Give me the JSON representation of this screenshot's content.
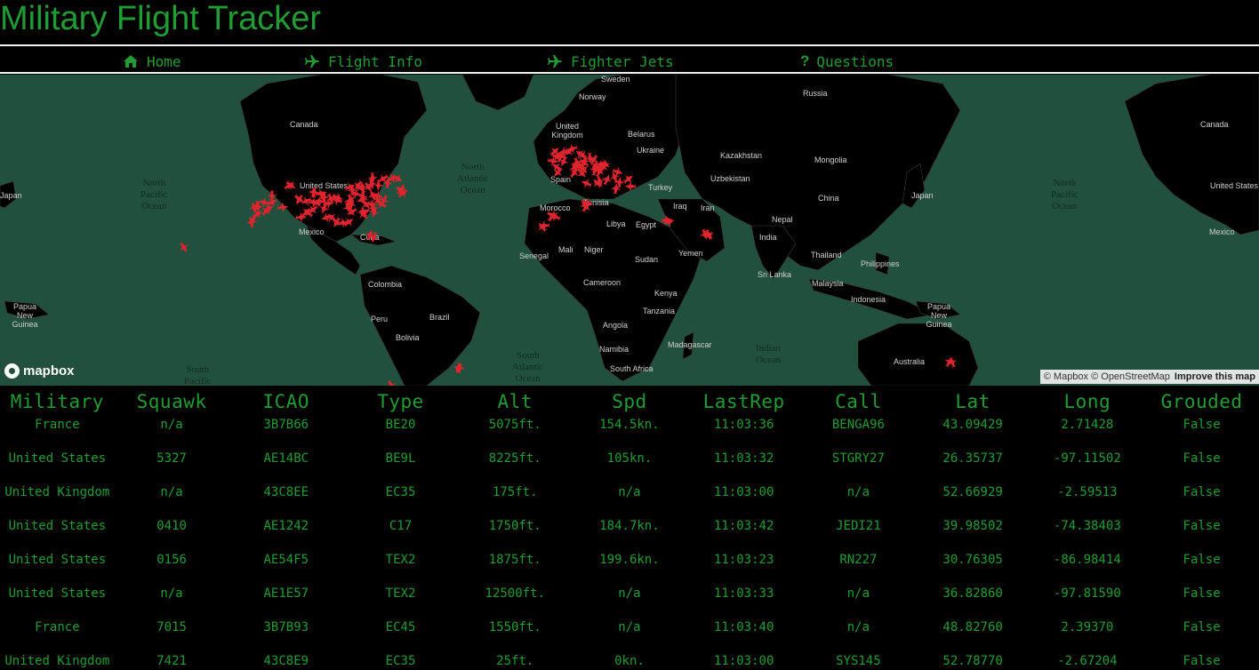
{
  "app": {
    "title": "Military Flight Tracker"
  },
  "nav": [
    {
      "label": "Home",
      "icon": "home-icon"
    },
    {
      "label": "Flight Info",
      "icon": "plane-icon"
    },
    {
      "label": "Fighter Jets",
      "icon": "plane-icon"
    },
    {
      "label": "Questions",
      "icon": "question-icon"
    }
  ],
  "map": {
    "countries": [
      "Canada",
      "United States",
      "Mexico",
      "Cuba",
      "Colombia",
      "Peru",
      "Brazil",
      "Bolivia",
      "Norway",
      "Sweden",
      "United Kingdom",
      "Belarus",
      "Ukraine",
      "Spain",
      "Turkey",
      "Tunisia",
      "Morocco",
      "Iraq",
      "Iran",
      "Libya",
      "Egypt",
      "Mali",
      "Niger",
      "Sudan",
      "Senegal",
      "Yemen",
      "Cameroon",
      "Kenya",
      "Tanzania",
      "Angola",
      "Namibia",
      "South Africa",
      "Madagascar",
      "Russia",
      "Kazakhstan",
      "Uzbekistan",
      "Mongolia",
      "China",
      "Nepal",
      "India",
      "Thailand",
      "Sri Lanka",
      "Malaysia",
      "Philippines",
      "Indonesia",
      "Japan",
      "Papua New Guinea",
      "Australia",
      "Canada",
      "United States",
      "Mexico",
      "Japan",
      "Papua New Guinea"
    ],
    "oceans": [
      "North\nPacific\nOcean",
      "North\nAtlantic\nOcean",
      "South\nPacific",
      "South\nAtlantic\nOcean",
      "Indian\nOcean",
      "North\nPacific\nOcean"
    ],
    "logo_text": "mapbox",
    "attribution": "© Mapbox © OpenStreetMap",
    "attribution_link": "Improve this map",
    "aircraft_color": "#e0242e"
  },
  "table": {
    "headers": [
      "Military",
      "Squawk",
      "ICAO",
      "Type",
      "Alt",
      "Spd",
      "LastRep",
      "Call",
      "Lat",
      "Long",
      "Grouded"
    ],
    "rows": [
      [
        "France",
        "n/a",
        "3B7B66",
        "BE20",
        "5075ft.",
        "154.5kn.",
        "11:03:36",
        "BENGA96",
        "43.09429",
        "2.71428",
        "False"
      ],
      [
        "United States",
        "5327",
        "AE14BC",
        "BE9L",
        "8225ft.",
        "105kn.",
        "11:03:32",
        "STGRY27",
        "26.35737",
        "-97.11502",
        "False"
      ],
      [
        "United Kingdom",
        "n/a",
        "43C8EE",
        "EC35",
        "175ft.",
        "n/a",
        "11:03:00",
        "n/a",
        "52.66929",
        "-2.59513",
        "False"
      ],
      [
        "United States",
        "0410",
        "AE1242",
        "C17",
        "1750ft.",
        "184.7kn.",
        "11:03:42",
        "JEDI21",
        "39.98502",
        "-74.38403",
        "False"
      ],
      [
        "United States",
        "0156",
        "AE54F5",
        "TEX2",
        "1875ft.",
        "199.6kn.",
        "11:03:23",
        "RN227",
        "30.76305",
        "-86.98414",
        "False"
      ],
      [
        "United States",
        "n/a",
        "AE1E57",
        "TEX2",
        "12500ft.",
        "n/a",
        "11:03:33",
        "n/a",
        "36.82860",
        "-97.81590",
        "False"
      ],
      [
        "France",
        "7015",
        "3B7B93",
        "EC45",
        "1550ft.",
        "n/a",
        "11:03:40",
        "n/a",
        "48.82760",
        "2.39370",
        "False"
      ],
      [
        "United Kingdom",
        "7421",
        "43C8E9",
        "EC35",
        "25ft.",
        "0kn.",
        "11:03:00",
        "SYS145",
        "52.78770",
        "-2.67204",
        "False"
      ]
    ]
  }
}
